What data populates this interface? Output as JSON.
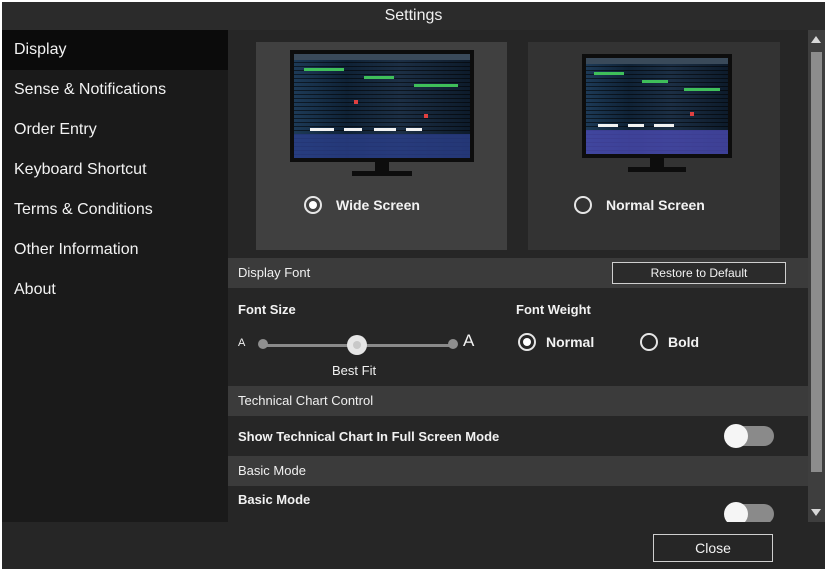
{
  "window": {
    "title": "Settings"
  },
  "sidebar": {
    "items": [
      {
        "label": "Display",
        "active": true
      },
      {
        "label": "Sense & Notifications"
      },
      {
        "label": "Order Entry"
      },
      {
        "label": "Keyboard Shortcut"
      },
      {
        "label": "Terms & Conditions"
      },
      {
        "label": "Other Information"
      },
      {
        "label": "About"
      }
    ]
  },
  "screen_mode": {
    "options": [
      {
        "label": "Wide Screen",
        "selected": true
      },
      {
        "label": "Normal Screen",
        "selected": false
      }
    ]
  },
  "display_font": {
    "header": "Display Font",
    "restore_label": "Restore to Default",
    "font_size_label": "Font Size",
    "small_a": "A",
    "large_a": "A",
    "slider_value_label": "Best Fit",
    "slider_position": "middle",
    "font_weight_label": "Font Weight",
    "weights": [
      {
        "label": "Normal",
        "selected": true
      },
      {
        "label": "Bold",
        "selected": false
      }
    ]
  },
  "technical_chart": {
    "header": "Technical Chart Control",
    "setting_label": "Show Technical Chart In Full Screen Mode",
    "toggle_on": false
  },
  "basic_mode": {
    "header": "Basic Mode",
    "setting_label": "Basic Mode",
    "toggle_on": false
  },
  "footer": {
    "close_label": "Close"
  },
  "colors": {
    "background": "#1b1b1b",
    "panel": "#262626",
    "header": "#3b3b3b",
    "accent": "#ffffff"
  }
}
